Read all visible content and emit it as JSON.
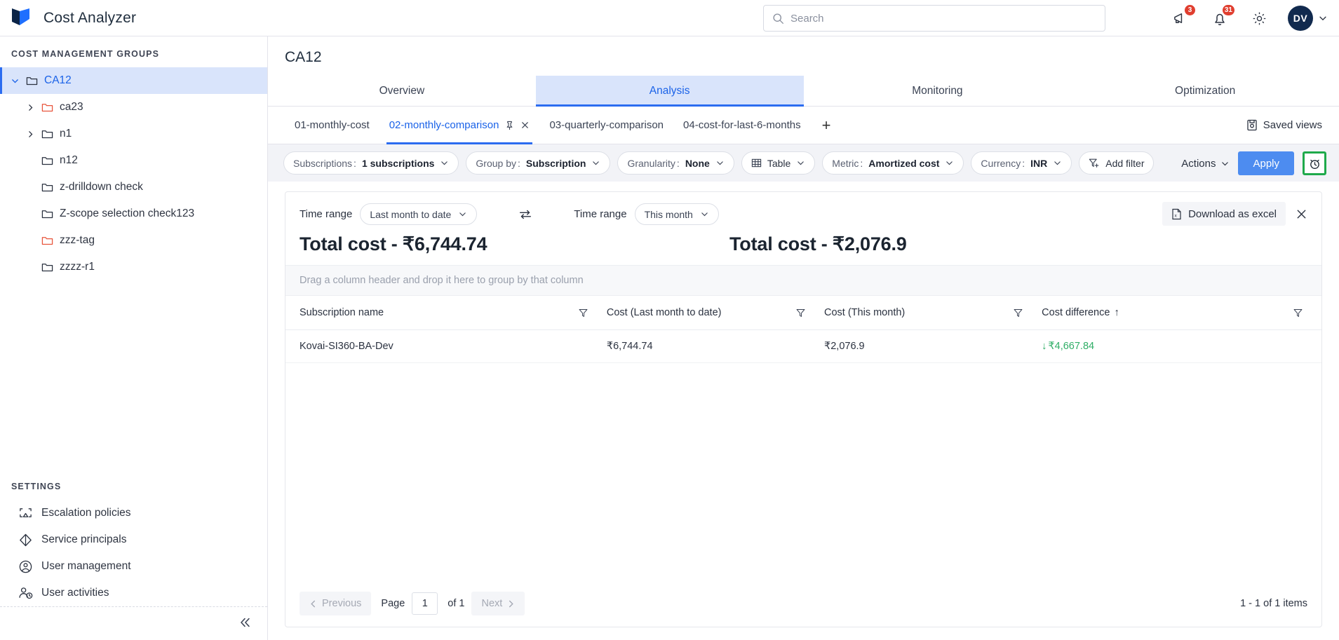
{
  "app": {
    "brand_name": "Cost Analyzer",
    "logo_icon": "logo-icon",
    "colors": {
      "accent_blue": "#2b6cf0",
      "apply_blue": "#4d8cf0",
      "active_tab_bg": "#d9e4fb",
      "badge_red": "#e03e2f",
      "highlight_green": "#1faa4b",
      "decrease_green": "#2fae66",
      "folder_red": "#e8553c"
    }
  },
  "header": {
    "search": {
      "placeholder": "Search",
      "value": "",
      "icon": "search-icon"
    },
    "announcements": {
      "icon": "megaphone-icon",
      "badge": "3"
    },
    "notifications": {
      "icon": "bell-icon",
      "badge": "31"
    },
    "settings": {
      "icon": "gear-icon"
    },
    "account": {
      "initials": "DV",
      "icon": "chevron-down-icon"
    }
  },
  "sidebar": {
    "section_title": "COST MANAGEMENT GROUPS",
    "tree": [
      {
        "label": "CA12",
        "depth": 0,
        "chevron": "down",
        "folder_color": "dark",
        "active": true
      },
      {
        "label": "ca23",
        "depth": 1,
        "chevron": "right",
        "folder_color": "red",
        "active": false
      },
      {
        "label": "n1",
        "depth": 1,
        "chevron": "right",
        "folder_color": "dark",
        "active": false
      },
      {
        "label": "n12",
        "depth": 1,
        "chevron": "none",
        "folder_color": "dark",
        "active": false
      },
      {
        "label": "z-drilldown check",
        "depth": 1,
        "chevron": "none",
        "folder_color": "dark",
        "active": false
      },
      {
        "label": "Z-scope selection check123",
        "depth": 1,
        "chevron": "none",
        "folder_color": "dark",
        "active": false
      },
      {
        "label": "zzz-tag",
        "depth": 1,
        "chevron": "none",
        "folder_color": "red",
        "active": false
      },
      {
        "label": "zzzz-r1",
        "depth": 1,
        "chevron": "none",
        "folder_color": "dark",
        "active": false
      }
    ],
    "settings_title": "SETTINGS",
    "settings_items": [
      {
        "label": "Escalation policies",
        "icon": "escalation-icon"
      },
      {
        "label": "Service principals",
        "icon": "diamond-icon"
      },
      {
        "label": "User management",
        "icon": "user-circle-icon"
      },
      {
        "label": "User activities",
        "icon": "user-clock-icon"
      }
    ],
    "collapse_icon": "collapse-left-icon"
  },
  "main": {
    "page_title": "CA12",
    "nav_tabs": [
      {
        "label": "Overview",
        "active": false
      },
      {
        "label": "Analysis",
        "active": true
      },
      {
        "label": "Monitoring",
        "active": false
      },
      {
        "label": "Optimization",
        "active": false
      }
    ],
    "view_tabs": [
      {
        "label": "01-monthly-cost",
        "active": false,
        "pinned": false,
        "closable": false
      },
      {
        "label": "02-monthly-comparison",
        "active": true,
        "pinned": true,
        "closable": true
      },
      {
        "label": "03-quarterly-comparison",
        "active": false,
        "pinned": false,
        "closable": false
      },
      {
        "label": "04-cost-for-last-6-months",
        "active": false,
        "pinned": false,
        "closable": false
      }
    ],
    "add_tab_label": "+",
    "saved_views_label": "Saved views",
    "saved_views_icon": "saved-views-icon"
  },
  "filters": {
    "pills": [
      {
        "name": "Subscriptions",
        "value": "1 subscriptions"
      },
      {
        "name": "Group by",
        "value": "Subscription"
      },
      {
        "name": "Granularity",
        "value": "None"
      },
      {
        "name": "Metric",
        "value": "Amortized cost"
      },
      {
        "name": "Currency",
        "value": "INR"
      }
    ],
    "view_type": {
      "label": "Table",
      "icon": "table-icon"
    },
    "add_filter": {
      "label": "Add filter",
      "icon": "filter-plus-icon"
    },
    "actions_label": "Actions",
    "apply_label": "Apply",
    "alarm_icon": "alarm-clock-icon",
    "alarm_highlighted": true
  },
  "comparison": {
    "left": {
      "time_range_label": "Time range",
      "time_range_value": "Last month to date",
      "total_label": "Total cost - ₹6,744.74"
    },
    "right": {
      "time_range_label": "Time range",
      "time_range_value": "This month",
      "total_label": "Total cost - ₹2,076.9"
    },
    "swap_icon": "swap-horizontal-icon",
    "download_label": "Download as excel",
    "download_icon": "excel-file-icon",
    "close_icon": "close-icon"
  },
  "table": {
    "group_hint": "Drag a column header and drop it here to group by that column",
    "columns": [
      {
        "label": "Subscription name",
        "sort": "",
        "filter_icon": "filter-icon"
      },
      {
        "label": "Cost (Last month to date)",
        "sort": "",
        "filter_icon": "filter-icon"
      },
      {
        "label": "Cost (This month)",
        "sort": "",
        "filter_icon": "filter-icon"
      },
      {
        "label": "Cost difference",
        "sort": "↑",
        "filter_icon": "filter-icon"
      }
    ],
    "rows": [
      {
        "subscription_name": "Kovai-SI360-BA-Dev",
        "cost_last_month_to_date": "₹6,744.74",
        "cost_this_month": "₹2,076.9",
        "cost_difference": "₹4,667.84",
        "cost_difference_direction": "down"
      }
    ]
  },
  "pagination": {
    "previous_label": "Previous",
    "next_label": "Next",
    "page_label": "Page",
    "page_value": "1",
    "of_label": "of 1",
    "items_summary": "1 - 1 of 1 items"
  }
}
